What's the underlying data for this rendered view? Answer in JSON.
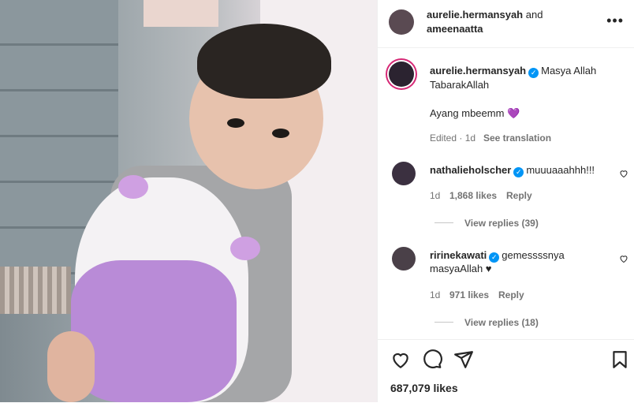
{
  "header": {
    "users": "aurelie.hermansyah",
    "joiner": "and",
    "second_user": "ameenaatta",
    "more_icon": "more-horizontal-icon"
  },
  "caption": {
    "username": "aurelie.hermansyah",
    "text_line1": "Masya Allah",
    "text_line2": "TabarakAllah",
    "text_line3": "Ayang mbeemm",
    "emoji": "💜",
    "meta": "Edited · 1d",
    "see_translation": "See translation"
  },
  "comments": [
    {
      "username": "nathalieholscher",
      "text": "muuuaaahhh!!!",
      "time": "1d",
      "likes": "1,868 likes",
      "reply": "Reply",
      "view_replies": "View replies (39)"
    },
    {
      "username": "ririnekawati",
      "text_line1": "gemessssnya",
      "text_line2": "masyaAllah ♥",
      "time": "1d",
      "likes": "971 likes",
      "reply": "Reply",
      "view_replies": "View replies (18)"
    }
  ],
  "actions": {
    "likes": "687,079 likes"
  },
  "colors": {
    "verified": "#0095f6",
    "story_ring": "#d62976",
    "emoji_heart": "#8e44c9"
  }
}
